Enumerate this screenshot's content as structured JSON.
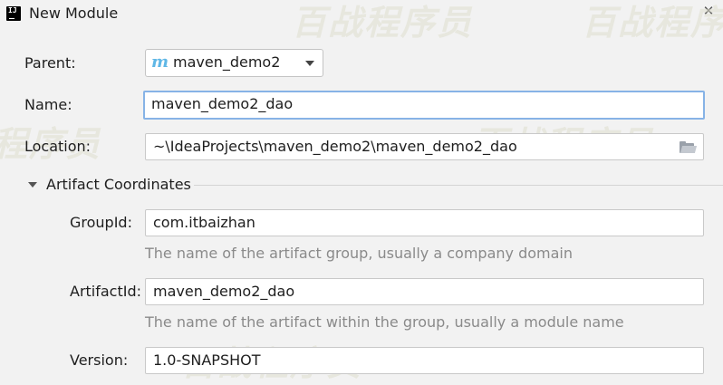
{
  "window": {
    "title": "New Module",
    "app_icon_glyph": "IJ",
    "close_glyph": "✕"
  },
  "watermark": {
    "text": "百战程序员"
  },
  "form": {
    "parent": {
      "label": "Parent:",
      "icon_glyph": "m",
      "value": "maven_demo2"
    },
    "name": {
      "label": "Name:",
      "value": "maven_demo2_dao"
    },
    "location": {
      "label": "Location:",
      "value": "~\\IdeaProjects\\maven_demo2\\maven_demo2_dao"
    }
  },
  "artifact": {
    "section_title": "Artifact Coordinates",
    "group_id": {
      "label": "GroupId:",
      "value": "com.itbaizhan",
      "hint": "The name of the artifact group, usually a company domain"
    },
    "artifact_id": {
      "label": "ArtifactId:",
      "value": "maven_demo2_dao",
      "hint": "The name of the artifact within the group, usually a module name"
    },
    "version": {
      "label": "Version:",
      "value": "1.0-SNAPSHOT"
    }
  },
  "colors": {
    "background": "#f2f2f2",
    "focus_border": "#87b3e6",
    "maven_icon": "#5fb7e6",
    "hint_text": "#8a8a8a"
  },
  "icons": {
    "app": "intellij-icon",
    "close": "close-icon",
    "parent": "maven-icon",
    "dropdown": "chevron-down-icon",
    "browse": "folder-icon",
    "section": "triangle-down-icon"
  }
}
